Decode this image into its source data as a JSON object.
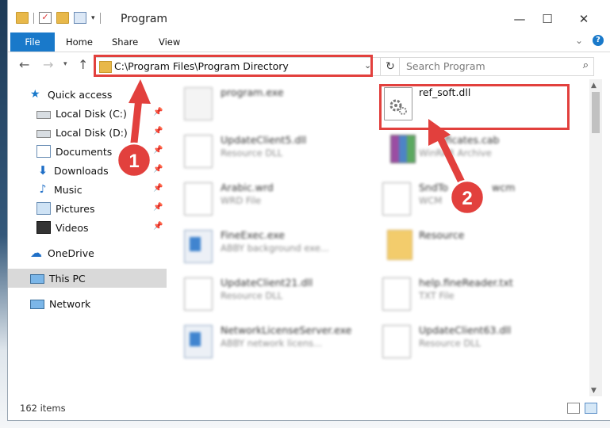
{
  "window": {
    "title": "Program",
    "controls": {
      "minimize": "—",
      "maximize": "☐",
      "close": "✕"
    }
  },
  "ribbon": {
    "tabs": [
      "File",
      "Home",
      "Share",
      "View"
    ]
  },
  "navbar": {
    "address": "C:\\Program Files\\Program Directory",
    "search_placeholder": "Search Program"
  },
  "sidebar": {
    "items": [
      {
        "label": "Quick access",
        "icon": "star-icon"
      },
      {
        "label": "Local Disk (C:)",
        "icon": "drive-icon",
        "pinned": true
      },
      {
        "label": "Local Disk (D:)",
        "icon": "drive-icon",
        "pinned": true
      },
      {
        "label": "Documents",
        "icon": "documents-icon",
        "pinned": true
      },
      {
        "label": "Downloads",
        "icon": "downloads-icon",
        "pinned": true
      },
      {
        "label": "Music",
        "icon": "music-icon",
        "pinned": true
      },
      {
        "label": "Pictures",
        "icon": "pictures-icon",
        "pinned": true
      },
      {
        "label": "Videos",
        "icon": "videos-icon",
        "pinned": true
      },
      {
        "label": "OneDrive",
        "icon": "cloud-icon"
      },
      {
        "label": "This PC",
        "icon": "pc-icon",
        "selected": true
      },
      {
        "label": "Network",
        "icon": "network-icon"
      }
    ]
  },
  "files": [
    {
      "name": "program.exe",
      "type": "",
      "icon": "exe-icon"
    },
    {
      "name": "ref_soft.dll",
      "type": "",
      "icon": "gear-dll-icon"
    },
    {
      "name": "UpdateClient5.dll",
      "type": "Resource DLL",
      "icon": "dll-icon"
    },
    {
      "name": "ificates.cab",
      "type": "WinRAR Archive",
      "icon": "rar-icon"
    },
    {
      "name": "Arabic.wrd",
      "type": "WRD File",
      "icon": "doc-icon"
    },
    {
      "name": "SndTo",
      "type": "WCM",
      "icon": "doc-icon"
    },
    {
      "name": "FineExec.exe",
      "type": "ABBY background exe...",
      "icon": "window-icon"
    },
    {
      "name": "Resource",
      "type": "",
      "icon": "folder-icon"
    },
    {
      "name": "UpdateClient21.dll",
      "type": "Resource DLL",
      "icon": "dll-icon"
    },
    {
      "name": "help.fineReader.txt",
      "type": "TXT File",
      "icon": "doc-icon"
    },
    {
      "name": "NetworkLicenseServer.exe",
      "type": "ABBY network licens...",
      "icon": "window-icon"
    },
    {
      "name": "UpdateClient63.dll",
      "type": "Resource DLL",
      "icon": "dll-icon"
    }
  ],
  "annotations": {
    "step1": "1",
    "step2": "2",
    "partial_name_suffix": "wcm"
  },
  "status": {
    "item_count": "162 items"
  },
  "colors": {
    "accent": "#1979ca",
    "highlight": "#e2403d",
    "selected": "#d9d9d9"
  }
}
